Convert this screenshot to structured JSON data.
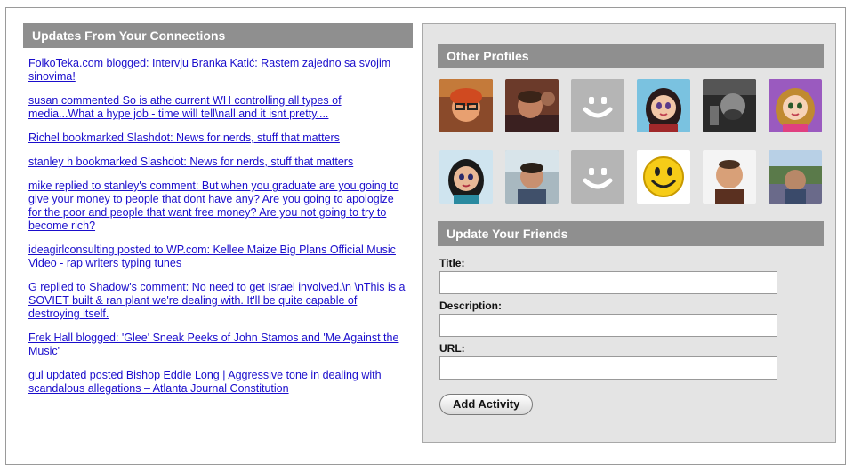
{
  "connections": {
    "title": "Updates From Your Connections",
    "items": [
      "FolkoTeka.com blogged: Intervju Branka Katić: Rastem zajedno sa svojim sinovima!",
      "susan commented So is athe current WH controlling all types of media...What a hype job - time will tell\\nall and it isnt pretty....",
      "Richel bookmarked Slashdot: News for nerds, stuff that matters",
      "stanley h bookmarked Slashdot: News for nerds, stuff that matters",
      "mike replied to stanley's comment: But when you graduate are you going to give your money to people that dont have any? Are you going to apologize for the poor and people that want free money? Are you not going to try to become rich?",
      "ideagirlconsulting posted to WP.com: Kellee Maize Big Plans Official Music Video - rap writers typing tunes",
      "G replied to Shadow's comment: No need to get Israel involved.\\n \\nThis is a SOVIET built & ran plant we're dealing with. It'll be quite capable of destroying itself.",
      "Frek Hall blogged: 'Glee' Sneak Peeks of John Stamos and 'Me Against the Music'",
      "gul updated posted Bishop Eddie Long | Aggressive tone in dealing with scandalous allegations – Atlanta Journal Constitution"
    ]
  },
  "profiles": {
    "title": "Other Profiles"
  },
  "update": {
    "title": "Update Your Friends",
    "title_label": "Title:",
    "title_value": "",
    "description_label": "Description:",
    "description_value": "",
    "url_label": "URL:",
    "url_value": "",
    "button_label": "Add Activity"
  }
}
